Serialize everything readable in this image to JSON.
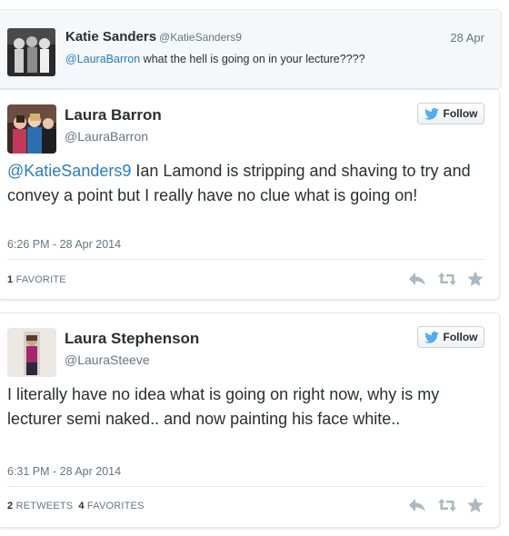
{
  "reply_context": {
    "name": "Katie Sanders",
    "handle": "@KatieSanders9",
    "date": "28 Apr",
    "mention": "@LauraBarron",
    "text": " what the hell is going on in your lecture????"
  },
  "tweets": [
    {
      "name": "Laura Barron",
      "handle": "@LauraBarron",
      "follow_label": "Follow",
      "mention": "@KatieSanders9",
      "text": " Ian Lamond is stripping and shaving to try and convey a point but I really have no clue what is going on!",
      "timestamp": "6:26 PM - 28 Apr 2014",
      "favorites_count": "1",
      "favorites_label": "FAVORITE"
    },
    {
      "name": "Laura Stephenson",
      "handle": "@LauraSteeve",
      "follow_label": "Follow",
      "text": "I literally have no idea what is going on right now, why is my lecturer semi naked.. and now painting his face white..",
      "timestamp": "6:31 PM - 28 Apr 2014",
      "retweets_count": "2",
      "retweets_label": "RETWEETS",
      "favorites_count": "4",
      "favorites_label": "FAVORITES"
    }
  ],
  "icons": {
    "follow": "twitter-bird-icon",
    "reply": "reply-icon",
    "retweet": "retweet-icon",
    "favorite": "star-icon"
  },
  "colors": {
    "link": "#2b7bb9",
    "follow_bird": "#55acee",
    "action_icons": "#aab8c2",
    "muted_text": "#66757f"
  }
}
